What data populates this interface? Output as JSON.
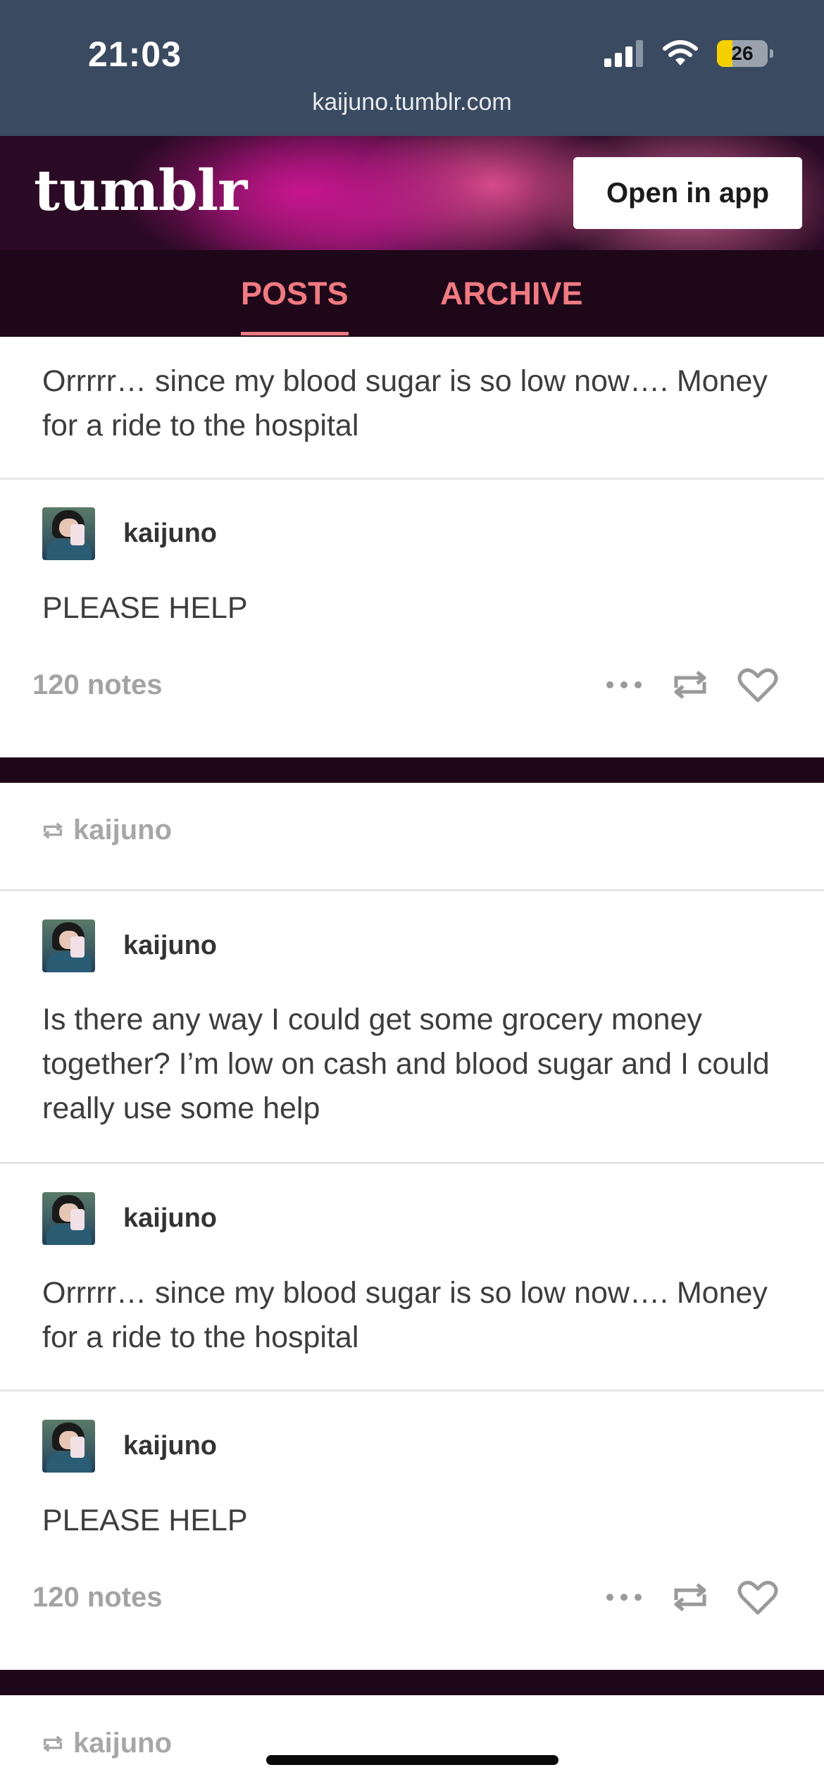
{
  "status_bar": {
    "time": "21:03",
    "battery": "26",
    "url": "kaijuno.tumblr.com"
  },
  "header": {
    "logo": "tumblr",
    "open_app": "Open in app"
  },
  "tabs": [
    {
      "label": "POSTS",
      "active": true
    },
    {
      "label": "ARCHIVE",
      "active": false
    }
  ],
  "colors": {
    "accent": "#f07a82",
    "dark_bg": "#1e0719",
    "status_bg": "#3a4a60"
  },
  "feed": {
    "top_text": "Orrrrr… since my blood sugar is so low now…. Money for a ride to the hospital",
    "post1": {
      "user": "kaijuno",
      "text": "PLEASE HELP",
      "notes": "120 notes"
    },
    "reblog1": {
      "user": "kaijuno"
    },
    "post2": {
      "user": "kaijuno",
      "text": "Is there any way I could get some grocery money together? I’m low on cash and blood sugar and I could really use some help"
    },
    "post3": {
      "user": "kaijuno",
      "text": "Orrrrr… since my blood sugar is so low now…. Money for a ride to the hospital"
    },
    "post4": {
      "user": "kaijuno",
      "text": "PLEASE HELP",
      "notes": "120 notes"
    },
    "reblog2": {
      "user": "kaijuno"
    }
  },
  "icons": [
    "signal-icon",
    "wifi-icon",
    "battery-icon",
    "more-icon",
    "reblog-icon",
    "heart-icon"
  ]
}
